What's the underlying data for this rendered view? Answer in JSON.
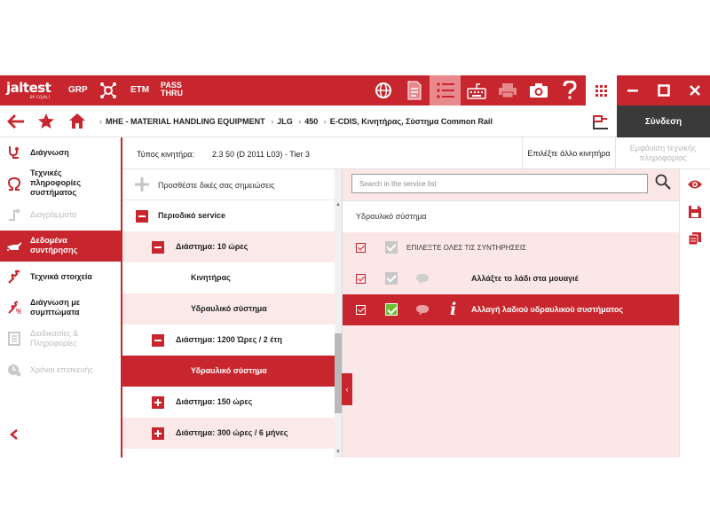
{
  "topbar": {
    "logo": "jaltest",
    "logo_sub": "BY COJALI",
    "grp": "GRP",
    "etm": "ETM",
    "pass": "PASS",
    "thru": "THRU",
    "icons": [
      "globe-icon",
      "document-icon",
      "list-icon",
      "keyboard-icon",
      "printer-icon",
      "camera-icon",
      "help-icon",
      "apps-grid-icon",
      "minimize-icon",
      "maximize-icon",
      "close-icon"
    ],
    "accent": "#c8262e"
  },
  "navbar": {
    "breadcrumbs": [
      "MHE - MATERIAL HANDLING EQUIPMENT",
      "JLG",
      "450",
      "E-CDIS, Κινητήρας, Σύστημα Common Rail"
    ],
    "connect_label": "Σύνδεση"
  },
  "sidebar": {
    "items": [
      {
        "label": "Διάγνωση",
        "icon": "stethoscope-icon"
      },
      {
        "label": "Τεχνικές πληροφορίες συστήματος",
        "icon": "omega-icon"
      },
      {
        "label": "Διαγράμματα",
        "icon": "diagram-icon"
      },
      {
        "label": "Δεδομένα συντήρησης",
        "icon": "oil-can-icon"
      },
      {
        "label": "Τεχνικά στοιχεία",
        "icon": "wrench-icon"
      },
      {
        "label": "Διάγνωση με συμπτώματα",
        "icon": "symptom-icon"
      },
      {
        "label": "Διαδικασίες & Πληροφορίες",
        "icon": "procedures-icon"
      },
      {
        "label": "Χρόνοι επισκευής",
        "icon": "repair-time-icon"
      }
    ],
    "collapse_icon": "chevron-left-icon"
  },
  "engine": {
    "label": "Τύπος κινητήρα:",
    "value": "2.3 50 (D 2011 L03) - Tier 3",
    "choose_label": "Επιλέξτε άλλο κινητήρα",
    "tech_info_label": "Εμφάνιση τεχνικής πληροφορίας"
  },
  "tree": {
    "add_note": "Προσθέστε δικές σας σημειώσεις",
    "rows": [
      {
        "label": "Περιοδικό service",
        "state": "expanded"
      },
      {
        "label": "Διάστημα: 10 ώρες",
        "state": "expanded"
      },
      {
        "label": "Κινητήρας",
        "state": "leaf"
      },
      {
        "label": "Υδραυλικό σύστημα",
        "state": "leaf"
      },
      {
        "label": "Διάστημα: 1200 Ώρες / 2 έτη",
        "state": "expanded"
      },
      {
        "label": "Υδραυλικό σύστημα",
        "state": "selected"
      },
      {
        "label": "Διάστημα: 150 ώρες",
        "state": "collapsed"
      },
      {
        "label": "Διάστημα: 300 ώρες / 6 μήνες",
        "state": "collapsed"
      }
    ]
  },
  "service_list": {
    "search_placeholder": "Search in the service list",
    "section": "Υδραυλικό σύστημα",
    "select_all": "ΕΠΙΛΕΞΤΕ ΟΛΕΣ ΤΙΣ ΣΥΝΤΗΡΗΣΕΙΣ",
    "rows": [
      {
        "label": "Αλλάξτε το λάδι στα μουαγιέ",
        "checked": true,
        "selected": false
      },
      {
        "label": "Αλλαγή λαδιού υδραυλικού συστήματος",
        "checked": true,
        "selected": true
      }
    ]
  },
  "right_actions": [
    "eye-icon",
    "save-icon",
    "copy-icon"
  ]
}
